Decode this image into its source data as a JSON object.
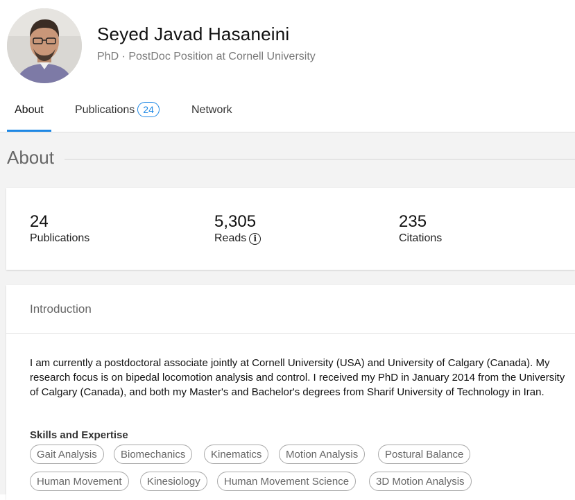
{
  "profile": {
    "name": "Seyed Javad Hasaneini",
    "subtitle": "PhD · PostDoc Position at Cornell University"
  },
  "tabs": [
    {
      "label": "About",
      "active": true
    },
    {
      "label": "Publications",
      "badge": "24"
    },
    {
      "label": "Network"
    }
  ],
  "section": {
    "title": "About"
  },
  "stats": [
    {
      "value": "24",
      "label": "Publications"
    },
    {
      "value": "5,305",
      "label": "Reads",
      "icon": "info-icon"
    },
    {
      "value": "235",
      "label": "Citations"
    }
  ],
  "intro": {
    "heading": "Introduction",
    "text": "I am currently a postdoctoral associate jointly at Cornell University (USA) and University of Calgary (Canada). My research focus is on bipedal locomotion analysis and control. I received my PhD in January 2014 from the University of Calgary (Canada), and both my Master's and Bachelor's degrees from Sharif University of Technology in Iran."
  },
  "skills": {
    "heading": "Skills and Expertise",
    "items": [
      "Gait Analysis",
      "Biomechanics",
      "Kinematics",
      "Motion Analysis",
      "Postural Balance",
      "Human Movement",
      "Kinesiology",
      "Human Movement Science",
      "3D Motion Analysis"
    ]
  },
  "colors": {
    "accent": "#1e88e5",
    "background": "#f3f3f3"
  }
}
